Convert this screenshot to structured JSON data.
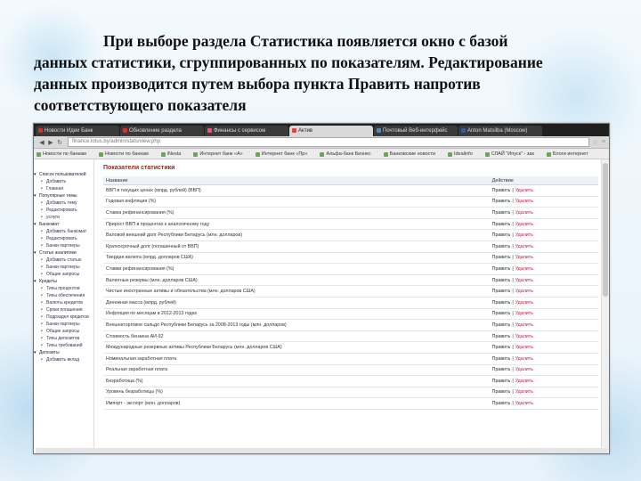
{
  "slide": {
    "title_lines": [
      "При выборе раздела Статистика появляется окно с базой",
      "данных статистики, сгруппированных по показателям. Редактирование",
      "данных производится путем выбора пункта Править напротив",
      "соответствующего показателя"
    ]
  },
  "browser": {
    "tabs": [
      "Новости Идеи Банк",
      "Обновление раздела",
      "Финансы с сервисом",
      "Актив",
      "Почтовый Веб-интерфейс",
      "Anton Matsilba (Moscow)"
    ],
    "url": "finance.lotus.by/admin/stats/view.php",
    "bookmarks": [
      "Новости по банкам",
      "Новости по банкам",
      "iNesta",
      "Интернет банк «А»",
      "Интернет банк «Пр»",
      "Альфа-банк Бизнес",
      "Банковские новости",
      "Idealinfo",
      "СЛАЙ \"Ипуск\" - зак",
      "Блоги интернет"
    ]
  },
  "sidebar": {
    "items": [
      {
        "label": "Список пользователей",
        "type": "top"
      },
      {
        "label": "Добавить",
        "type": "sub"
      },
      {
        "label": "Главная",
        "type": "sub"
      },
      {
        "label": "Популярные темы",
        "type": "top"
      },
      {
        "label": "Добавить тему",
        "type": "sub"
      },
      {
        "label": "Редактировать",
        "type": "sub"
      },
      {
        "label": "услуги",
        "type": "sub"
      },
      {
        "label": "Банкомат",
        "type": "top"
      },
      {
        "label": "Добавить банкомат",
        "type": "sub"
      },
      {
        "label": "Редактировать",
        "type": "sub"
      },
      {
        "label": "Банки партнеры",
        "type": "sub"
      },
      {
        "label": "Статьи аналитики",
        "type": "top"
      },
      {
        "label": "Добавить статью",
        "type": "sub"
      },
      {
        "label": "Банки партнеры",
        "type": "sub"
      },
      {
        "label": "Общие запросы",
        "type": "sub"
      },
      {
        "label": "Кредиты",
        "type": "top"
      },
      {
        "label": "Типы процентов",
        "type": "sub"
      },
      {
        "label": "Типы обеспечения",
        "type": "sub"
      },
      {
        "label": "Валюты кредитов",
        "type": "sub"
      },
      {
        "label": "Сроки погашения",
        "type": "sub"
      },
      {
        "label": "Подраздел кредитов",
        "type": "sub"
      },
      {
        "label": "Банки партнеры",
        "type": "sub"
      },
      {
        "label": "Общие запросы",
        "type": "sub"
      },
      {
        "label": "Типы депозитов",
        "type": "sub"
      },
      {
        "label": "Типы требований",
        "type": "sub"
      },
      {
        "label": "Депозиты",
        "type": "top"
      },
      {
        "label": "Добавить вклад",
        "type": "sub"
      }
    ]
  },
  "main": {
    "title": "Показатели статистики",
    "columns": [
      "Название",
      "Действие"
    ],
    "edit_label": "Править",
    "delete_label": "Удалить",
    "separator": "|",
    "rows": [
      "ВВП в текущих ценах (млрд. рублей) (ВВП)",
      "Годовая инфляция (%)",
      "Ставка рефинансирования (%)",
      "Прирост ВВП в процентах к аналогичному году",
      "Валовой внешний долг Республики Беларусь (млн. долларов)",
      "Краткосрочный долг (погашенный от ВВП)",
      "Твердая валюта (млрд. долларов США)",
      "Ставки рефинансирования (%)",
      "Валютные резервы (млн. долларов США)",
      "Чистые иностранные активы и обязательства (млн. долларов США)",
      "Денежная масса (млрд. рублей)",
      "Инфляция по месяцам в 2012-2013 годах",
      "Внешнеторговое сальдо Республики Беларусь за 2008-2013 годы (млн. долларов)",
      "Стоимость бензина АИ-92",
      "Международные резервные активы Республики Беларусь (млн. долларов США)",
      "Номинальная заработная плата",
      "Реальная заработная плата",
      "Безработица (%)",
      "Уровень безработицы (%)",
      "Импорт - экспорт (млн. долларов)"
    ]
  }
}
